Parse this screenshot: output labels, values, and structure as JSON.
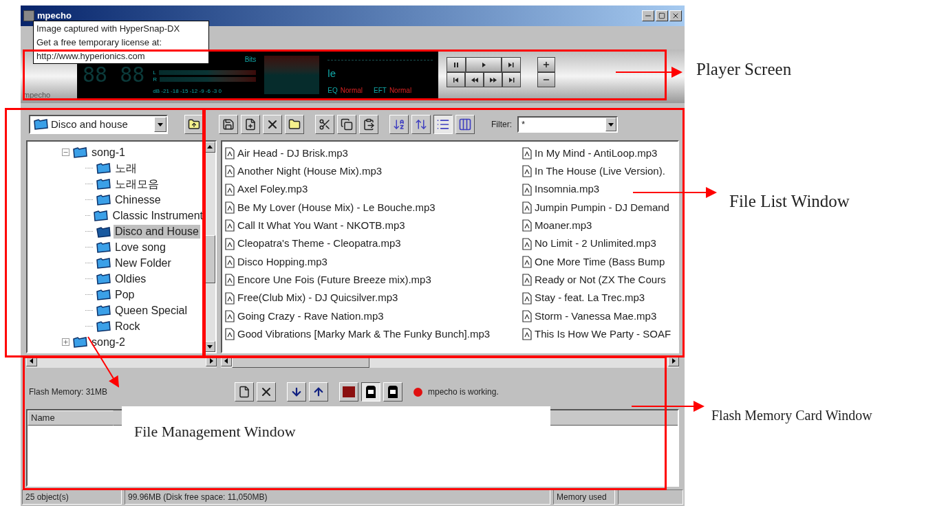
{
  "window": {
    "title": "mpecho"
  },
  "tooltip": {
    "lines": [
      "Image captured with HyperSnap-DX",
      "Get a free temporary license at:",
      "http://www.hyperionics.com"
    ]
  },
  "player": {
    "logo": "mpecho",
    "time": "88 88",
    "bitrate_label": "Bits",
    "channels": [
      "L",
      "R"
    ],
    "scale": "dB -21 -18 -15 -12 -9 -6 -3 0",
    "track_text": "le",
    "eq_label": "EQ",
    "eq_value": "Normal",
    "eft_label": "EFT",
    "eft_value": "Normal"
  },
  "folder_combo": {
    "value": "Disco and house"
  },
  "view_buttons": [
    {
      "kind": "list",
      "selected": true
    },
    {
      "kind": "details",
      "selected": false
    }
  ],
  "filter": {
    "label": "Filter:",
    "value": "*"
  },
  "tree": [
    {
      "label": "song-1",
      "expanded": true,
      "children": [
        {
          "label": "노래",
          "selected": false
        },
        {
          "label": "노래모음",
          "selected": false
        },
        {
          "label": "Chinesse",
          "selected": false
        },
        {
          "label": "Classic Instrument",
          "selected": false
        },
        {
          "label": "Disco and House",
          "selected": true
        },
        {
          "label": "Love song",
          "selected": false
        },
        {
          "label": "New Folder",
          "selected": false
        },
        {
          "label": "Oldies",
          "selected": false
        },
        {
          "label": "Pop",
          "selected": false
        },
        {
          "label": "Queen Special",
          "selected": false
        },
        {
          "label": "Rock",
          "selected": false
        }
      ]
    },
    {
      "label": "song-2",
      "expanded": false
    }
  ],
  "files": {
    "column_1": [
      "Air Head - DJ Brisk.mp3",
      "Another Night (House Mix).mp3",
      "Axel Foley.mp3",
      "Be My Lover (House Mix) - Le Bouche.mp3",
      "Call It What You Want - NKOTB.mp3",
      "Cleopatra's Theme - Cleopatra.mp3",
      "Disco Hopping.mp3",
      "Encore Une Fois (Future Breeze mix).mp3",
      "Free(Club Mix) - DJ Quicsilver.mp3",
      "Going Crazy - Rave Nation.mp3",
      "Good Vibrations [Marky Mark & The Funky Bunch].mp3"
    ],
    "column_2": [
      "In My Mind - AntiLoop.mp3",
      "In The House (Live Version).",
      "Insomnia.mp3",
      "Jumpin Pumpin - DJ Demand",
      "Moaner.mp3",
      "No Limit - 2 Unlimited.mp3",
      "One More Time (Bass Bump",
      "Ready or Not (ZX The Cours",
      "Stay - feat. La Trec.mp3",
      "Storm - Vanessa Mae.mp3",
      "This Is How We Party - SOAF"
    ]
  },
  "flash": {
    "label": "Flash Memory: 31MB",
    "status": "mpecho is working."
  },
  "flash_list": {
    "columns": [
      "Name"
    ]
  },
  "status_bar": [
    "25 object(s)",
    "99.96MB (Disk free space: 11,050MB)",
    "Memory used"
  ],
  "annotations": [
    "Player Screen",
    "File List Window",
    "File Management Window",
    "Flash Memory Card Window"
  ]
}
